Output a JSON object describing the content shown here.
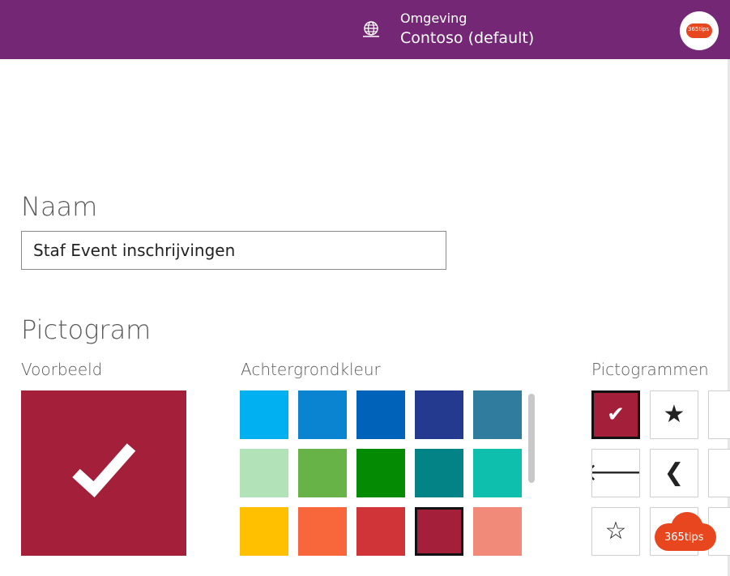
{
  "header": {
    "environment_label": "Omgeving",
    "environment_value": "Contoso (default)",
    "env_icon": "globe-icon",
    "avatar_text": "365tips",
    "bar_color": "#742774"
  },
  "form": {
    "name_heading": "Naam",
    "name_value": "Staf Event inschrijvingen",
    "icon_heading": "Pictogram",
    "preview_label": "Voorbeeld",
    "background_label": "Achtergrondkleur",
    "icons_label": "Pictogrammen",
    "preview_color": "#a4203a"
  },
  "background_colors": [
    "#00b0f0",
    "#0a84d0",
    "#0062b8",
    "#243a8f",
    "#2f7c9e",
    "#b2e2b8",
    "#68b348",
    "#058a04",
    "#038386",
    "#0fbfad",
    "#ffc000",
    "#f8663b",
    "#d13438",
    "#a4203a",
    "#f28a7a"
  ],
  "selected_color_index": 13,
  "icons": [
    {
      "name": "checkmark-icon",
      "glyph": "✔",
      "selected": true
    },
    {
      "name": "star-filled-icon",
      "glyph": "★"
    },
    {
      "name": "arrow-left-icon",
      "glyph": "🡐"
    },
    {
      "name": "chevron-left-icon",
      "glyph": "❮"
    },
    {
      "name": "star-outline-icon",
      "glyph": "☆"
    },
    {
      "name": "arrow-right-icon",
      "glyph": "➜"
    }
  ],
  "watermark": "365tips"
}
